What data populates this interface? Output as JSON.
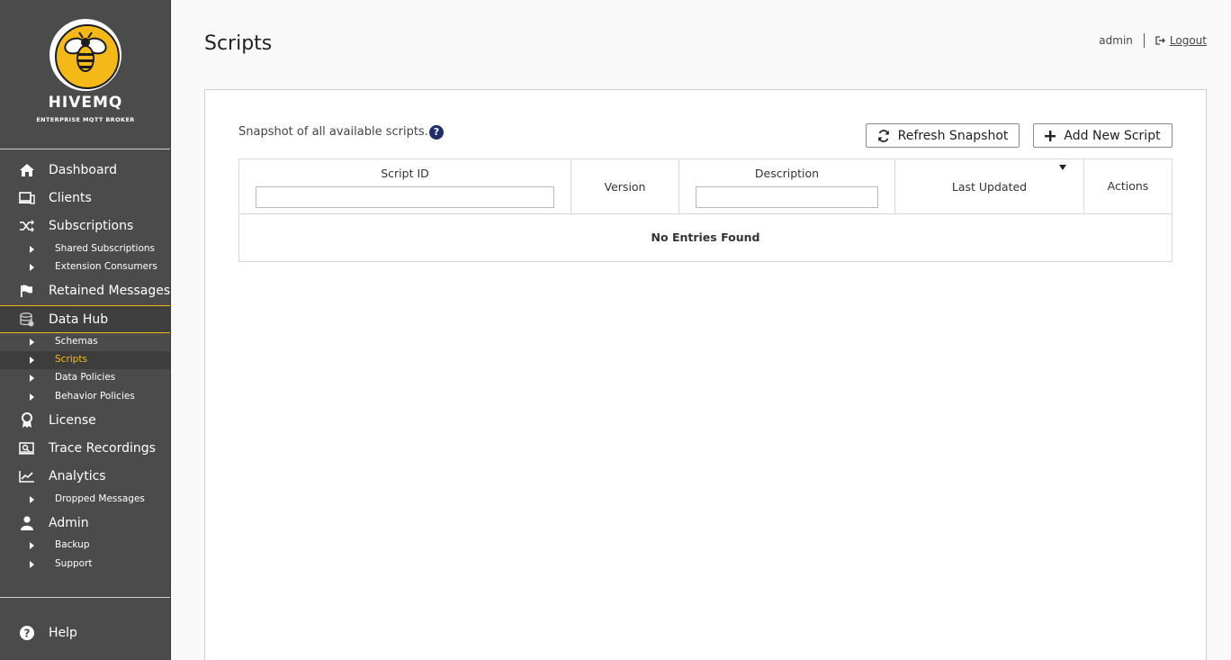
{
  "brand": {
    "name": "HIVEMQ",
    "tagline": "ENTERPRISE MQTT BROKER",
    "accent_color": "#f5b917"
  },
  "sidebar": {
    "items": [
      {
        "label": "Dashboard",
        "icon": "home-icon"
      },
      {
        "label": "Clients",
        "icon": "devices-icon"
      },
      {
        "label": "Subscriptions",
        "icon": "shuffle-icon",
        "children": [
          "Shared Subscriptions",
          "Extension Consumers"
        ]
      },
      {
        "label": "Retained Messages",
        "icon": "flag-icon"
      },
      {
        "label": "Data Hub",
        "icon": "database-icon",
        "active": true,
        "children": [
          "Schemas",
          "Scripts",
          "Data Policies",
          "Behavior Policies"
        ],
        "active_child": "Scripts"
      },
      {
        "label": "License",
        "icon": "award-icon"
      },
      {
        "label": "Trace Recordings",
        "icon": "trace-icon"
      },
      {
        "label": "Analytics",
        "icon": "line-chart-icon",
        "children": [
          "Dropped Messages"
        ]
      },
      {
        "label": "Admin",
        "icon": "user-icon",
        "children": [
          "Backup",
          "Support"
        ]
      }
    ],
    "help_label": "Help"
  },
  "header": {
    "title": "Scripts",
    "user": "admin",
    "logout_label": "Logout"
  },
  "main": {
    "description": "Snapshot of all available scripts.",
    "refresh_label": "Refresh Snapshot",
    "add_label": "Add New Script",
    "table": {
      "columns": [
        "Script ID",
        "Version",
        "Description",
        "Last Updated",
        "Actions"
      ],
      "empty_message": "No Entries Found"
    }
  }
}
